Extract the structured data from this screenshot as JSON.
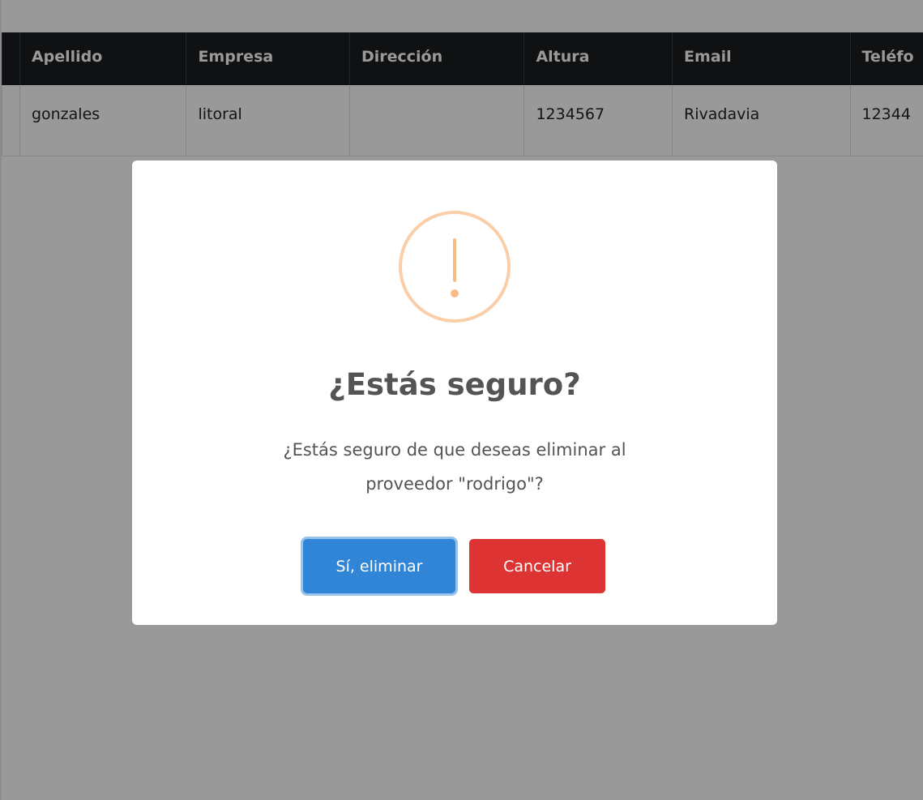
{
  "table": {
    "headers": [
      "",
      "Apellido",
      "Empresa",
      "Dirección",
      "Altura",
      "Email",
      "Teléfo"
    ],
    "rows": [
      [
        "",
        "gonzales",
        "litoral",
        "",
        "1234567",
        "Rivadavia",
        "12344"
      ]
    ]
  },
  "dialog": {
    "icon": "warning-exclamation-icon",
    "title": "¿Estás seguro?",
    "text_line1": "¿Estás seguro de que deseas eliminar al",
    "text_line2": "proveedor \"rodrigo\"?",
    "confirm_label": "Sí, eliminar",
    "cancel_label": "Cancelar"
  },
  "colors": {
    "header_bg": "#1a1d21",
    "confirm_button": "#3085d6",
    "cancel_button": "#dd3333",
    "warning_icon": "#f8bb86"
  }
}
